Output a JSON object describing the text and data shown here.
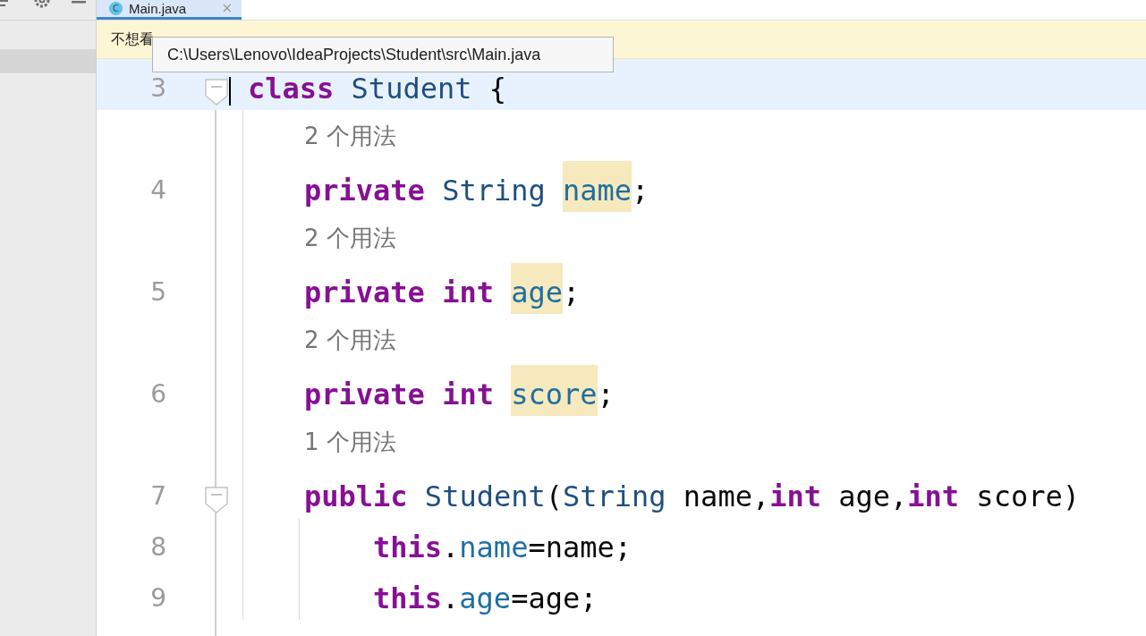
{
  "tab": {
    "icon_letter": "C",
    "title": "Main.java",
    "close": "×",
    "selected": true
  },
  "banner": {
    "text": "不想看"
  },
  "tooltip": {
    "text": "C:\\Users\\Lenovo\\IdeaProjects\\Student\\src\\Main.java"
  },
  "code": [
    {
      "kind": "code",
      "number": "3",
      "current": true,
      "foldable": true,
      "tokens": [
        {
          "kind": "keyword",
          "text": "class ",
          "highlighted": false
        },
        {
          "kind": "type",
          "text": "Student ",
          "highlighted": false
        },
        {
          "kind": "plain",
          "text": "{",
          "highlighted": false
        }
      ],
      "children": [
        {
          "kind": "hint",
          "text": "2 个用法"
        },
        {
          "kind": "code",
          "number": "4",
          "current": false,
          "foldable": false,
          "tokens": [
            {
              "kind": "keyword",
              "text": "private ",
              "highlighted": false
            },
            {
              "kind": "type",
              "text": "String ",
              "highlighted": false
            },
            {
              "kind": "field",
              "text": "name",
              "highlighted": true
            },
            {
              "kind": "plain",
              "text": ";",
              "highlighted": false
            }
          ]
        },
        {
          "kind": "hint",
          "text": "2 个用法"
        },
        {
          "kind": "code",
          "number": "5",
          "current": false,
          "foldable": false,
          "tokens": [
            {
              "kind": "keyword",
              "text": "private int ",
              "highlighted": false
            },
            {
              "kind": "field",
              "text": "age",
              "highlighted": true
            },
            {
              "kind": "plain",
              "text": ";",
              "highlighted": false
            }
          ]
        },
        {
          "kind": "hint",
          "text": "2 个用法"
        },
        {
          "kind": "code",
          "number": "6",
          "current": false,
          "foldable": false,
          "tokens": [
            {
              "kind": "keyword",
              "text": "private int ",
              "highlighted": false
            },
            {
              "kind": "field",
              "text": "score",
              "highlighted": true
            },
            {
              "kind": "plain",
              "text": ";",
              "highlighted": false
            }
          ]
        },
        {
          "kind": "hint",
          "text": "1 个用法"
        },
        {
          "kind": "code",
          "number": "7",
          "current": false,
          "foldable": true,
          "tokens": [
            {
              "kind": "keyword",
              "text": "public ",
              "highlighted": false
            },
            {
              "kind": "type",
              "text": "Student",
              "highlighted": false
            },
            {
              "kind": "plain",
              "text": "(",
              "highlighted": false
            },
            {
              "kind": "type",
              "text": "String ",
              "highlighted": false
            },
            {
              "kind": "plain",
              "text": "name,",
              "highlighted": false
            },
            {
              "kind": "keyword",
              "text": "int ",
              "highlighted": false
            },
            {
              "kind": "plain",
              "text": "age,",
              "highlighted": false
            },
            {
              "kind": "keyword",
              "text": "int ",
              "highlighted": false
            },
            {
              "kind": "plain",
              "text": "score)",
              "highlighted": false
            }
          ],
          "children": [
            {
              "kind": "code",
              "number": "8",
              "current": false,
              "foldable": false,
              "tokens": [
                {
                  "kind": "keyword",
                  "text": "this",
                  "highlighted": false
                },
                {
                  "kind": "plain",
                  "text": ".",
                  "highlighted": false
                },
                {
                  "kind": "field",
                  "text": "name",
                  "highlighted": false
                },
                {
                  "kind": "plain",
                  "text": "=name;",
                  "highlighted": false
                }
              ]
            },
            {
              "kind": "code",
              "number": "9",
              "current": false,
              "foldable": false,
              "tokens": [
                {
                  "kind": "keyword",
                  "text": "this",
                  "highlighted": false
                },
                {
                  "kind": "plain",
                  "text": ".",
                  "highlighted": false
                },
                {
                  "kind": "field",
                  "text": "age",
                  "highlighted": false
                },
                {
                  "kind": "plain",
                  "text": "=age;",
                  "highlighted": false
                }
              ]
            }
          ]
        }
      ]
    }
  ]
}
